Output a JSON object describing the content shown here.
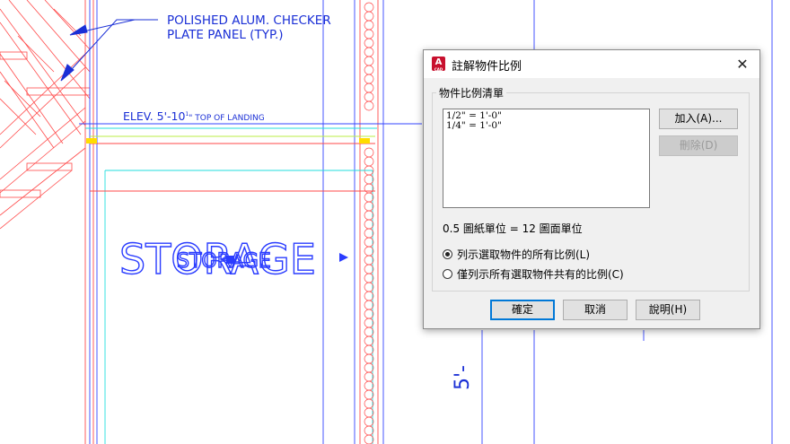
{
  "drawing": {
    "callout_line1": "POLISHED ALUM. CHECKER",
    "callout_line2": "PLATE PANEL (TYP.)",
    "elev_main": "ELEV. 5'-10",
    "elev_frac_num": "1",
    "elev_frac_den": "2",
    "elev_suffix": "\" TOP OF LANDING",
    "room_label": "STORAGE",
    "room_label_small": "STORAGE",
    "dimension_text": "5'-",
    "line_color": "#1a2fd6",
    "red_color": "#ff4040"
  },
  "dialog": {
    "title": "註解物件比例",
    "app_icon_letter": "A",
    "app_icon_sub": "CAD",
    "close_icon": "✕",
    "group_label": "物件比例清單",
    "scales": [
      "1/2\" = 1'-0\"",
      "1/4\" = 1'-0\""
    ],
    "add_button": "加入(A)...",
    "delete_button": "刪除(D)",
    "scale_info": "0.5 圖紙單位 = 12 圖面單位",
    "radio_all": "列示選取物件的所有比例(L)",
    "radio_common": "僅列示所有選取物件共有的比例(C)",
    "radio_selected": "all",
    "ok_button": "確定",
    "cancel_button": "取消",
    "help_button": "說明(H)"
  }
}
